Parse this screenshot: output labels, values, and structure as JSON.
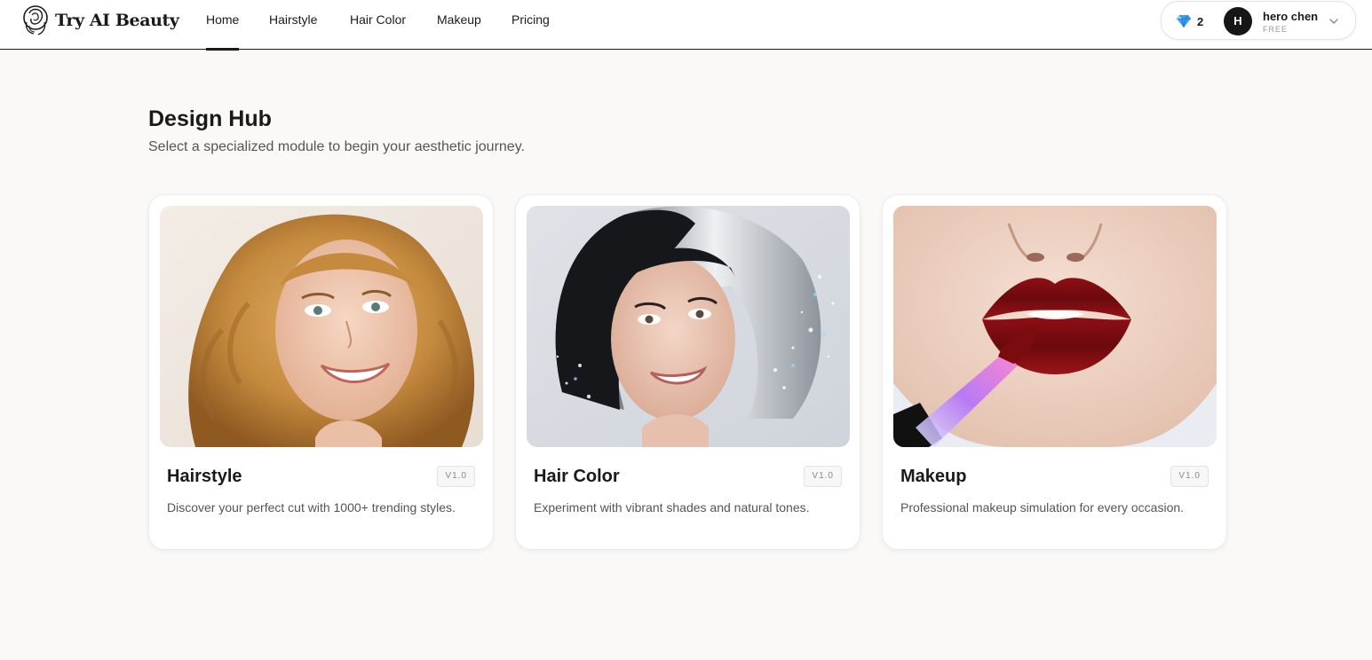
{
  "brand": {
    "name": "Try AI Beauty"
  },
  "nav": {
    "items": [
      {
        "label": "Home",
        "active": true
      },
      {
        "label": "Hairstyle",
        "active": false
      },
      {
        "label": "Hair Color",
        "active": false
      },
      {
        "label": "Makeup",
        "active": false
      },
      {
        "label": "Pricing",
        "active": false
      }
    ]
  },
  "user": {
    "credits": "2",
    "credits_icon": "gem-icon",
    "avatar_initial": "H",
    "name": "hero chen",
    "plan": "FREE"
  },
  "main": {
    "title": "Design Hub",
    "subtitle": "Select a specialized module to begin your aesthetic journey.",
    "cards": [
      {
        "title": "Hairstyle",
        "badge": "V1.0",
        "description": "Discover your perfect cut with 1000+ trending styles.",
        "image": "portrait of woman with wavy golden hair"
      },
      {
        "title": "Hair Color",
        "badge": "V1.0",
        "description": "Experiment with vibrant shades and natural tones.",
        "image": "portrait of woman with black and silver bob"
      },
      {
        "title": "Makeup",
        "badge": "V1.0",
        "description": "Professional makeup simulation for every occasion.",
        "image": "close-up of red lips with lip gloss applicator"
      }
    ]
  },
  "colors": {
    "background": "#faf9f7",
    "card": "#ffffff",
    "text": "#1a1a1a",
    "muted": "#555555",
    "avatar": "#161616",
    "gem": "#2f8fe8"
  }
}
